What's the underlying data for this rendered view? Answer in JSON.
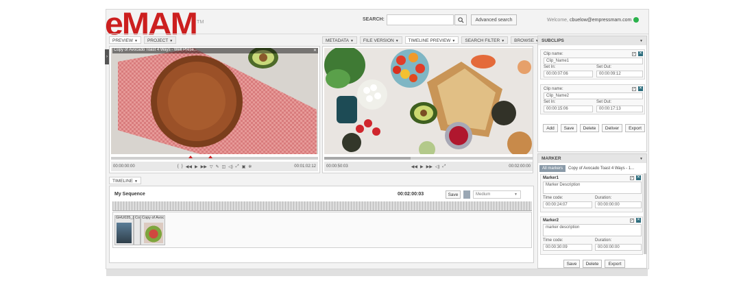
{
  "brand": {
    "logo_text": "eMAM",
    "trademark": "TM"
  },
  "header": {
    "search_label": "SEARCH:",
    "search_placeholder": "",
    "advanced_search": "Advanced search",
    "welcome_prefix": "Welcome,",
    "user_email": "cbuelow@empressmam.com",
    "status_color": "#2bb24c"
  },
  "left_tabs": [
    {
      "label": "PREVIEW"
    },
    {
      "label": "PROJECT"
    }
  ],
  "center_tabs": [
    {
      "label": "METADATA"
    },
    {
      "label": "FILE VERSION"
    },
    {
      "label": "TIMELINE PREVIEW"
    },
    {
      "label": "SEARCH FILTER"
    },
    {
      "label": "BROWSE"
    }
  ],
  "preview_player": {
    "title": "Copy of Avocado Toast 4 Ways - Well Prese...",
    "current_time": "00:00:00:00",
    "duration": "00:01:02:12"
  },
  "timeline_player": {
    "current_time": "00:00:50:03",
    "duration": "00:02:00:00"
  },
  "timeline": {
    "tab_label": "TIMELINE",
    "sequence_name": "My Sequence",
    "sequence_duration": "00:02:00:03",
    "save_label": "Save",
    "quality_value": "Medium",
    "clips": [
      {
        "label": "GHU035_("
      },
      {
        "label": "Co"
      },
      {
        "label": "Copy of Avoc"
      }
    ]
  },
  "subclips": {
    "title": "SUBCLIPS",
    "items": [
      {
        "name_label": "Clip name:",
        "name": "Clip_Name1",
        "in_label": "Set In:",
        "in": "00:00:07:06",
        "out_label": "Set Out:",
        "out": "00:00:09:12"
      },
      {
        "name_label": "Clip name:",
        "name": "Clip_Name2",
        "in_label": "Set In:",
        "in": "00:00:15:06",
        "out_label": "Set Out:",
        "out": "00:00:17:13"
      }
    ],
    "buttons": [
      "Add",
      "Save",
      "Delete",
      "Deliver",
      "Export"
    ]
  },
  "marker": {
    "title": "MARKER",
    "all_markers_tab": "All markers",
    "asset_tab": "Copy of Avocado Toast 4 Ways - 1...",
    "items": [
      {
        "name": "Marker1",
        "description": "Marker Description",
        "tc_label": "Time code:",
        "tc": "00:00:24:07",
        "dur_label": "Duration:",
        "dur": "00:00:00:00"
      },
      {
        "name": "Marker2",
        "description": "marker description",
        "tc_label": "Time code:",
        "tc": "00:00:30:09",
        "dur_label": "Duration:",
        "dur": "00:00:00:00"
      }
    ],
    "buttons": [
      "Save",
      "Delete",
      "Export"
    ]
  }
}
